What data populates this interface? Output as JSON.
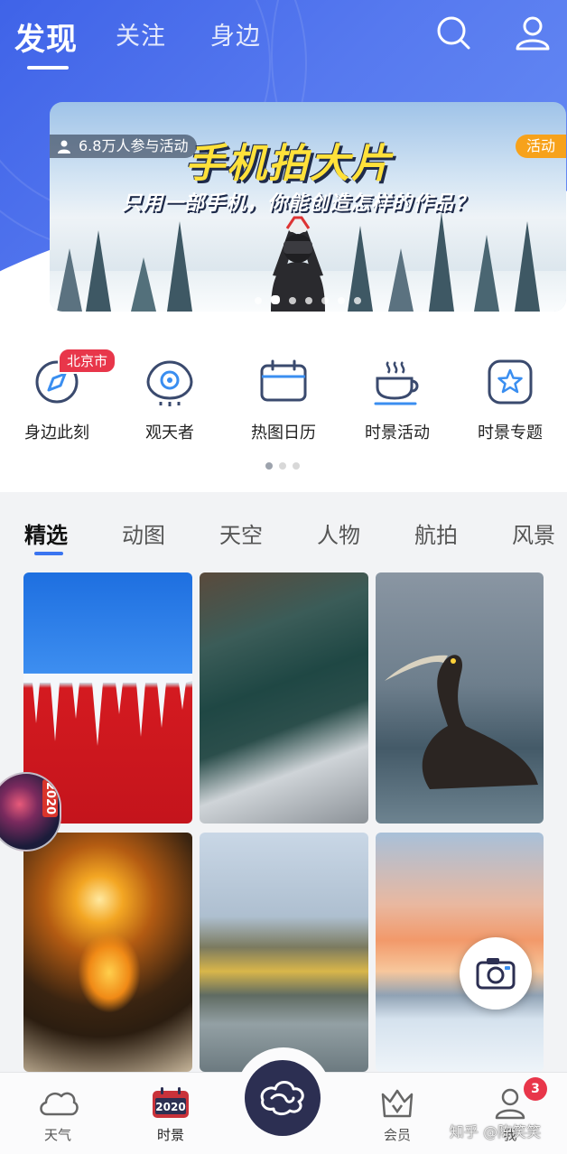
{
  "header": {
    "tabs": [
      {
        "label": "发现",
        "active": true
      },
      {
        "label": "关注",
        "active": false
      },
      {
        "label": "身边",
        "active": false
      }
    ],
    "icons": [
      "search-icon",
      "profile-icon"
    ],
    "accent_color": "#4a6ef0"
  },
  "banner": {
    "participants": "6.8万人参与活动",
    "badge": "活动",
    "title": "手机拍大片",
    "subtitle": "只用一部手机，你能创造怎样的作品？",
    "slide_count": 7,
    "active_slide": 2
  },
  "quick_entries": {
    "location_badge": "北京市",
    "items": [
      {
        "label": "身边此刻",
        "icon": "compass-icon"
      },
      {
        "label": "观天者",
        "icon": "eye-icon"
      },
      {
        "label": "热图日历",
        "icon": "calendar-icon"
      },
      {
        "label": "时景活动",
        "icon": "coffee-cup-icon"
      },
      {
        "label": "时景专题",
        "icon": "star-badge-icon"
      }
    ],
    "page_count": 3,
    "active_page": 1
  },
  "categories": {
    "tabs": [
      "精选",
      "动图",
      "天空",
      "人物",
      "航拍",
      "风景"
    ],
    "active": "精选"
  },
  "photos": [
    {
      "subject": "icicles on red wall"
    },
    {
      "subject": "aerial view of lake pavilion"
    },
    {
      "subject": "cormorant in water"
    },
    {
      "subject": "sunset reflection"
    },
    {
      "subject": "city skyline by river"
    },
    {
      "subject": "sunset over snow"
    }
  ],
  "floating": {
    "year_badge": "2020"
  },
  "bottom_nav": {
    "items": [
      {
        "label": "天气",
        "icon": "cloud-icon"
      },
      {
        "label": "时景",
        "icon": "calendar-2020-icon",
        "active": true
      },
      {
        "label": "",
        "icon": "cloud-logo-icon"
      },
      {
        "label": "会员",
        "icon": "crown-icon"
      },
      {
        "label": "我",
        "icon": "user-icon"
      }
    ],
    "calendar_text": "2020",
    "notification_count": "3"
  },
  "watermark": "知乎 @陈笑笑"
}
